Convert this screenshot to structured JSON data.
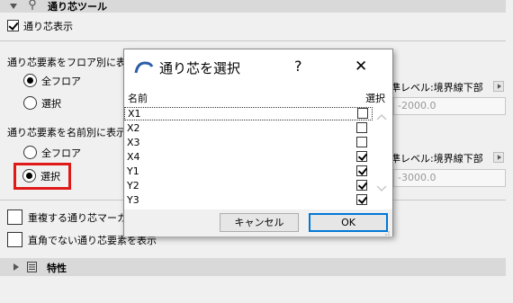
{
  "tool_header": {
    "label": "通り芯ツール"
  },
  "display_checkbox": {
    "label": "通り芯表示",
    "checked": true
  },
  "floor_section": {
    "label": "通り芯要素をフロア別に表示",
    "options": [
      "全フロア",
      "選択"
    ],
    "selected": "全フロア"
  },
  "name_section": {
    "label": "通り芯要素を名前別に表示",
    "options": [
      "全フロア",
      "選択"
    ],
    "selected": "選択"
  },
  "overlap_checkbox": {
    "label": "重複する通り芯マーカー",
    "checked": false
  },
  "nonorth_checkbox": {
    "label": "直角でない通り芯要素を表示",
    "checked": false
  },
  "ref_level_1": {
    "label": "準レベル:境界線下部",
    "value": "-2000.0"
  },
  "ref_level_2": {
    "label": "準レベル:境界線下部",
    "value": "-3000.0"
  },
  "properties_header": {
    "label": "特性"
  },
  "dialog": {
    "title": "通り芯を選択",
    "help": "?",
    "close": "✕",
    "col_name": "名前",
    "col_select": "選択",
    "rows": [
      {
        "name": "X1",
        "checked": false
      },
      {
        "name": "X2",
        "checked": false
      },
      {
        "name": "X3",
        "checked": false
      },
      {
        "name": "X4",
        "checked": true
      },
      {
        "name": "Y1",
        "checked": true
      },
      {
        "name": "Y2",
        "checked": true
      },
      {
        "name": "Y3",
        "checked": true
      }
    ],
    "cancel_label": "キャンセル",
    "ok_label": "OK"
  },
  "colors": {
    "highlight": "#e01818",
    "accent": "#0078d7",
    "header_bg": "#d9d9d9"
  }
}
